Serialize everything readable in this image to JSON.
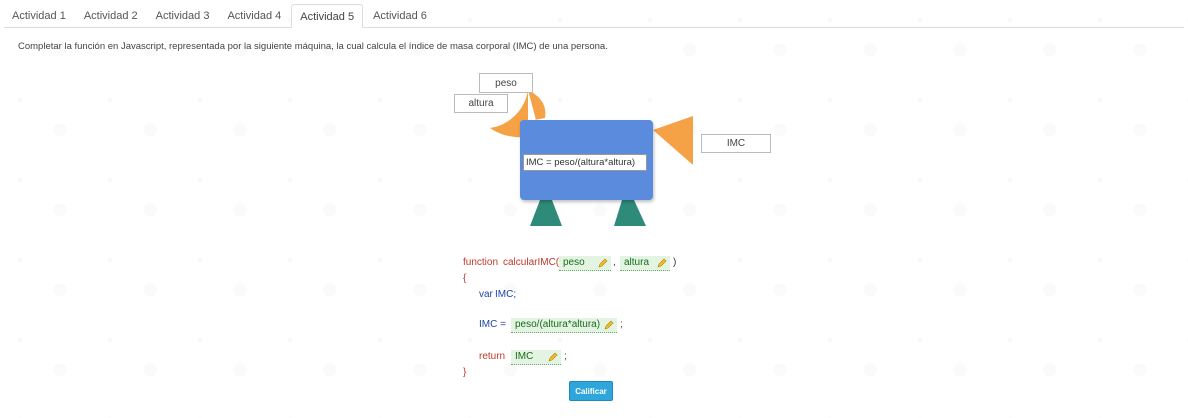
{
  "tabs": [
    {
      "label": "Actividad 1"
    },
    {
      "label": "Actividad 2"
    },
    {
      "label": "Actividad 3"
    },
    {
      "label": "Actividad 4"
    },
    {
      "label": "Actividad 5"
    },
    {
      "label": "Actividad 6"
    }
  ],
  "active_tab": "Actividad 5",
  "instruction": "Completar la función en Javascript, representada por la siguiente máquina, la cual calcula el índice de masa corporal (IMC) de una persona.",
  "machine": {
    "input1": "peso",
    "input2": "altura",
    "formula": "IMC = peso/(altura*altura)",
    "output": "IMC",
    "colors": {
      "body": "#5a8bdc",
      "funnel": "#f5a145",
      "legs": "#2e8b7a"
    }
  },
  "code": {
    "function_kw": "function",
    "function_name": "calcularIMC(",
    "comma": ",",
    "close_paren": ")",
    "open_brace": "{",
    "var_kw": "var",
    "var_name": "IMC;",
    "assign_lhs": "IMC =",
    "semicolon": ";",
    "return_kw": "return",
    "close_brace": "}",
    "slots": {
      "param1": "peso",
      "param2": "altura",
      "expression": "peso/(altura*altura)",
      "return_value": "IMC"
    }
  },
  "submit_label": "Calificar"
}
